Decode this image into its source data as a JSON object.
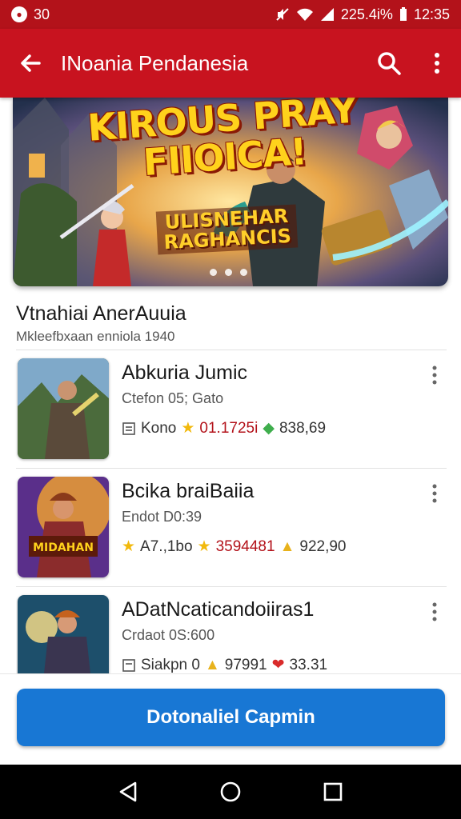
{
  "status_bar": {
    "notification_badge": "30",
    "battery_text": "225.4i%",
    "time": "12:35"
  },
  "app_bar": {
    "title": "INoania Pendanesia"
  },
  "banner": {
    "title_line1": "KIROUS PRAY",
    "title_line2": "FIIOICA!",
    "subtitle_line1": "ULISNEHAR",
    "subtitle_line2": "RAGHANCIS",
    "active_dot": 1
  },
  "section": {
    "title": "Vtnahiai AnerAuuia",
    "subtitle": "Mkleefbxaan enniola 1940"
  },
  "items": [
    {
      "title": "Abkuria Jumic",
      "meta": "Ctefon 05; Gato",
      "stat1_label": "Kono",
      "stat2_value": "01.1725i",
      "stat3_value": "838,69"
    },
    {
      "title": "Bcika braiBaiia",
      "meta": "Endot D0:39",
      "stat1_label": "A7.,1bo",
      "stat2_value": "3594481",
      "stat3_value": "922,90"
    },
    {
      "title": "ADatNcaticandoiiras1",
      "meta": "Crdaot 0S:600",
      "stat1_label": "Siakpn 0",
      "stat2_value": "97991",
      "stat3_value": "33.31"
    }
  ],
  "cta": {
    "label": "Dotonaliel Capmin"
  },
  "colors": {
    "app_bar": "#c8131f",
    "status_bar": "#b3121a",
    "cta": "#1877d4"
  },
  "icons": [
    "back-arrow-icon",
    "search-icon",
    "more-vert-icon",
    "wifi-icon",
    "signal-icon",
    "star-icon",
    "gem-icon",
    "doc-icon",
    "nav-back-icon",
    "nav-home-icon",
    "nav-recents-icon"
  ]
}
